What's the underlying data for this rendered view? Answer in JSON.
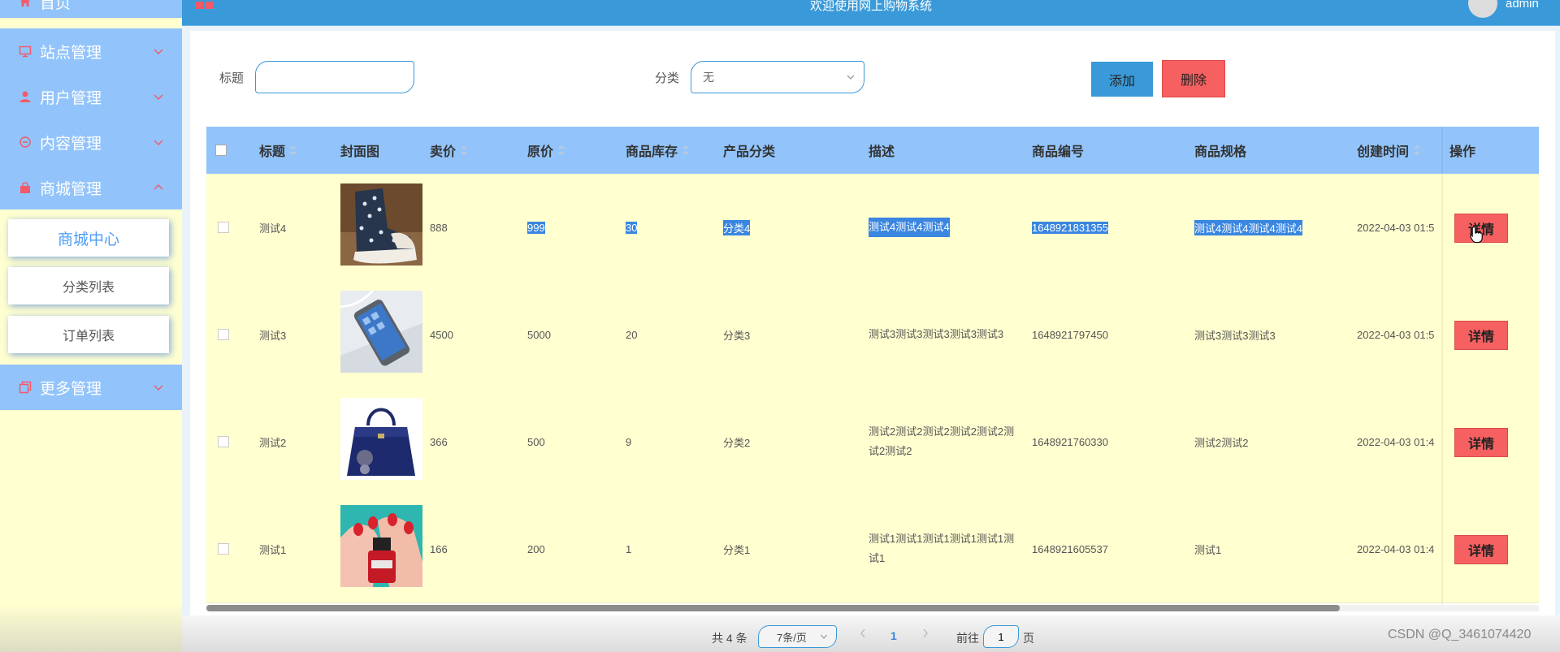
{
  "header": {
    "title": "欢迎使用网上购物系统",
    "username": "admin"
  },
  "sidebar": {
    "items": [
      {
        "label": "首页"
      },
      {
        "label": "站点管理"
      },
      {
        "label": "用户管理"
      },
      {
        "label": "内容管理"
      },
      {
        "label": "商城管理"
      },
      {
        "label": "更多管理"
      }
    ],
    "sub_items": [
      {
        "label": "商城中心"
      },
      {
        "label": "分类列表"
      },
      {
        "label": "订单列表"
      }
    ]
  },
  "search": {
    "title_label": "标题",
    "title_value": "",
    "category_label": "分类",
    "category_value": "无",
    "add_label": "添加",
    "delete_label": "删除"
  },
  "table": {
    "columns": [
      "标题",
      "封面图",
      "卖价",
      "原价",
      "商品库存",
      "产品分类",
      "描述",
      "商品编号",
      "商品规格",
      "创建时间",
      "操作"
    ],
    "detail_label": "详情",
    "rows": [
      {
        "title": "测试4",
        "image": "sneaker",
        "price": "888",
        "original": "999",
        "stock": "30",
        "category": "分类4",
        "desc": "测试4测试4测试4",
        "sku": "1648921831355",
        "spec": "测试4测试4测试4测试4",
        "created": "2022-04-03 01:5"
      },
      {
        "title": "测试3",
        "image": "phone",
        "price": "4500",
        "original": "5000",
        "stock": "20",
        "category": "分类3",
        "desc": "测试3测试3测试3测试3测试3",
        "sku": "1648921797450",
        "spec": "测试3测试3测试3",
        "created": "2022-04-03 01:5"
      },
      {
        "title": "测试2",
        "image": "handbag",
        "price": "366",
        "original": "500",
        "stock": "9",
        "category": "分类2",
        "desc": "测试2测试2测试2测试2测试2测试2测试2",
        "sku": "1648921760330",
        "spec": "测试2测试2",
        "created": "2022-04-03 01:4"
      },
      {
        "title": "测试1",
        "image": "nail-polish",
        "price": "166",
        "original": "200",
        "stock": "1",
        "category": "分类1",
        "desc": "测试1测试1测试1测试1测试1测试1",
        "sku": "1648921605537",
        "spec": "测试1",
        "created": "2022-04-03 01:4"
      }
    ]
  },
  "pagination": {
    "total_text": "共 4 条",
    "page_size": "7条/页",
    "current_page": "1",
    "goto_label": "前往",
    "goto_value": "1",
    "page_unit": "页"
  },
  "watermark": "CSDN @Q_3461074420",
  "colors": {
    "header": "#3a9ad9",
    "sidebar_item": "#92c4fb",
    "row_bg": "#ffffd0",
    "danger": "#f66060",
    "selection": "#3a86e0"
  }
}
